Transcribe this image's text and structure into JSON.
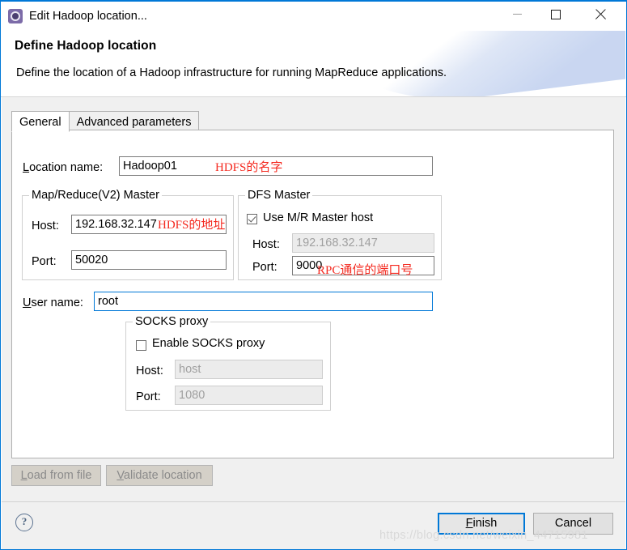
{
  "window": {
    "title": "Edit Hadoop location...",
    "icon": "hadoop-gear-icon",
    "controls": {
      "minimize": "minimize-icon",
      "maximize": "maximize-icon",
      "close": "close-icon"
    },
    "border_color": "#0078d7"
  },
  "header": {
    "title": "Define Hadoop location",
    "description": "Define the location of a Hadoop infrastructure for running MapReduce applications."
  },
  "tabs": [
    {
      "label": "General",
      "selected": true
    },
    {
      "label": "Advanced parameters",
      "selected": false
    }
  ],
  "form": {
    "location_name": {
      "label_mnemonic": "L",
      "label_rest": "ocation name:",
      "value": "Hadoop01",
      "annotation": "HDFS的名字"
    },
    "mr_master": {
      "title": "Map/Reduce(V2) Master",
      "host_label": "Host:",
      "host_value": "192.168.32.147",
      "host_annotation": "HDFS的地址",
      "port_label": "Port:",
      "port_value": "50020"
    },
    "dfs_master": {
      "title": "DFS Master",
      "use_mr_master_host_label": "Use M/R Master host",
      "use_mr_master_host_checked": true,
      "host_label": "Host:",
      "host_value": "192.168.32.147",
      "host_disabled": true,
      "port_label": "Port:",
      "port_value": "9000",
      "port_annotation": "RPC通信的端口号"
    },
    "user_name": {
      "label_mnemonic": "U",
      "label_rest": "ser name:",
      "value": "root"
    },
    "socks_proxy": {
      "title": "SOCKS proxy",
      "enable_label": "Enable SOCKS proxy",
      "enable_checked": false,
      "host_label": "Host:",
      "host_placeholder": "host",
      "host_disabled": true,
      "port_label": "Port:",
      "port_placeholder": "1080",
      "port_disabled": true
    }
  },
  "panel_buttons": {
    "load_from_file": {
      "mnemonic": "L",
      "rest": "oad from file",
      "disabled": true
    },
    "validate_location": {
      "mnemonic": "V",
      "rest": "alidate location",
      "disabled": true
    }
  },
  "footer": {
    "help_icon": "help-question-icon",
    "finish": {
      "mnemonic": "F",
      "rest": "inish",
      "default": true
    },
    "cancel": {
      "label": "Cancel"
    }
  },
  "watermark": "https://blog.csdn.net/weixin_44715981",
  "colors": {
    "accent": "#0078d7",
    "annotation_red": "#f4291f",
    "panel_bg": "#f0f0f0",
    "tab_panel_bg": "#ffffff"
  }
}
